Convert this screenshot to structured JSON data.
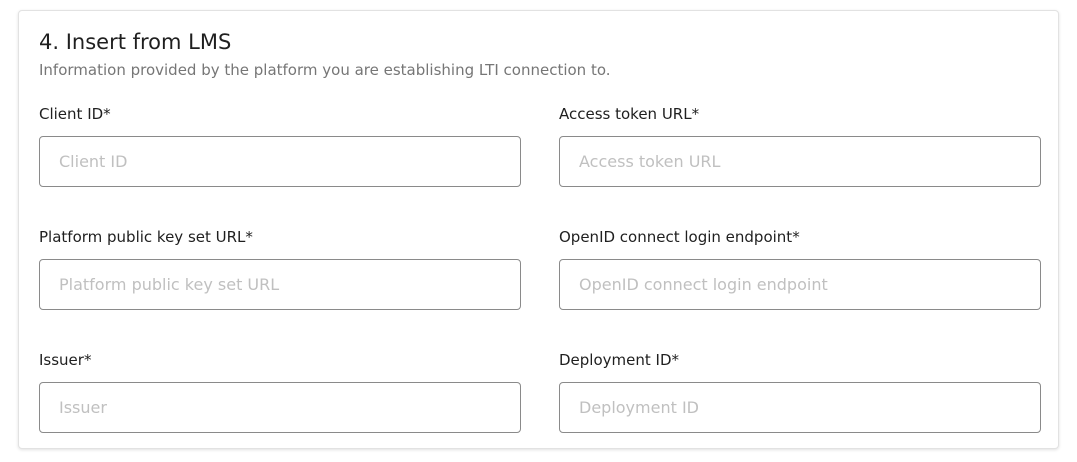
{
  "section": {
    "title": "4. Insert from LMS",
    "subtitle": "Information provided by the platform you are establishing LTI connection to."
  },
  "fields": [
    {
      "label": "Client ID*",
      "placeholder": "Client ID",
      "value": ""
    },
    {
      "label": "Access token URL*",
      "placeholder": "Access token URL",
      "value": ""
    },
    {
      "label": "Platform public key set URL*",
      "placeholder": "Platform public key set URL",
      "value": ""
    },
    {
      "label": "OpenID connect login endpoint*",
      "placeholder": "OpenID connect login endpoint",
      "value": ""
    },
    {
      "label": "Issuer*",
      "placeholder": "Issuer",
      "value": ""
    },
    {
      "label": "Deployment ID*",
      "placeholder": "Deployment ID",
      "value": ""
    }
  ]
}
